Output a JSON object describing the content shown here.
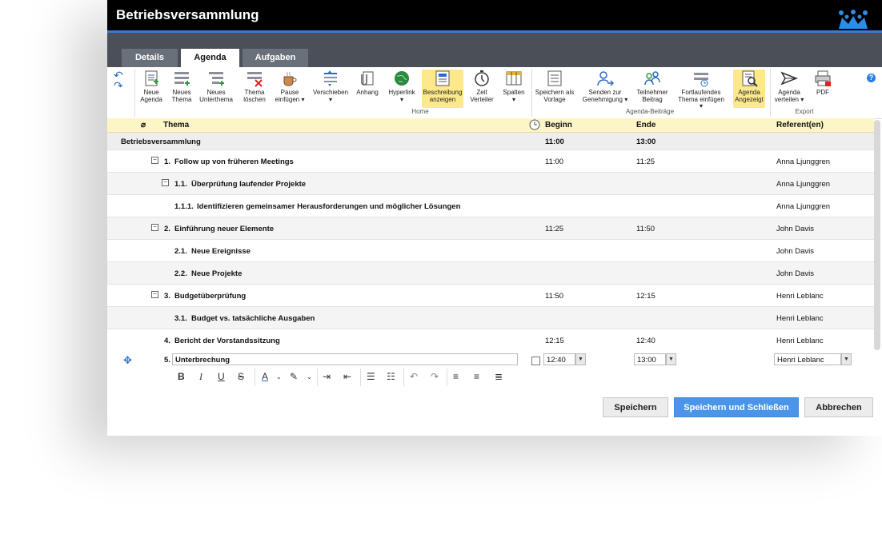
{
  "window": {
    "title": "Betriebsversammlung"
  },
  "tabs": [
    {
      "label": "Details"
    },
    {
      "label": "Agenda"
    },
    {
      "label": "Aufgaben"
    }
  ],
  "ribbon": {
    "buttons": [
      {
        "label": "Neue\nAgenda"
      },
      {
        "label": "Neues\nThema"
      },
      {
        "label": "Neues\nUnterthema"
      },
      {
        "label": "Thema\nlöschen"
      },
      {
        "label": "Pause\neinfügen ▾"
      },
      {
        "label": "Verschieben\n▾"
      },
      {
        "label": "Anhang"
      },
      {
        "label": "Hyperlink\n▾"
      },
      {
        "label": "Beschreibung\nanzeigen"
      },
      {
        "label": "Zeit\nVerteiler"
      },
      {
        "label": "Spalten\n▾"
      },
      {
        "label": "Speichern als\nVorlage"
      },
      {
        "label": "Senden zur\nGenehmigung ▾"
      },
      {
        "label": "Teilnehmer\nBeitrag"
      },
      {
        "label": "Fortlaufendes\nThema einfügen ▾"
      },
      {
        "label": "Agenda\nAngezeigt"
      },
      {
        "label": "Agenda\nverteilen ▾"
      },
      {
        "label": "PDF"
      }
    ],
    "groups": {
      "home": "Home",
      "agenda": "Agenda-Beiträge",
      "export": "Export"
    },
    "help": "?"
  },
  "grid": {
    "headers": {
      "thema": "Thema",
      "beginn": "Beginn",
      "ende": "Ende",
      "referent": "Referent(en)"
    },
    "root": {
      "title": "Betriebsversammlung",
      "beginn": "11:00",
      "ende": "13:00"
    },
    "rows": [
      {
        "num": "1.",
        "title": "Follow up von früheren Meetings",
        "beginn": "11:00",
        "ende": "11:25",
        "referent": "Anna Ljunggren"
      },
      {
        "num": "1.1.",
        "title": "Überprüfung laufender Projekte",
        "beginn": "",
        "ende": "",
        "referent": "Anna Ljunggren"
      },
      {
        "num": "1.1.1.",
        "title": "Identifizieren gemeinsamer Herausforderungen und möglicher Lösungen",
        "beginn": "",
        "ende": "",
        "referent": "Anna Ljunggren"
      },
      {
        "num": "2.",
        "title": "Einführung neuer Elemente",
        "beginn": "11:25",
        "ende": "11:50",
        "referent": "John Davis"
      },
      {
        "num": "2.1.",
        "title": "Neue Ereignisse",
        "beginn": "",
        "ende": "",
        "referent": "John Davis"
      },
      {
        "num": "2.2.",
        "title": "Neue Projekte",
        "beginn": "",
        "ende": "",
        "referent": "John Davis"
      },
      {
        "num": "3.",
        "title": "Budgetüberprüfung",
        "beginn": "11:50",
        "ende": "12:15",
        "referent": "Henri Leblanc"
      },
      {
        "num": "3.1.",
        "title": "Budget vs. tatsächliche Ausgaben",
        "beginn": "",
        "ende": "",
        "referent": "Henri Leblanc"
      },
      {
        "num": "4.",
        "title": "Bericht der Vorstandssitzung",
        "beginn": "12:15",
        "ende": "12:40",
        "referent": "Henri Leblanc"
      }
    ],
    "edit_row": {
      "num": "5.",
      "title": "Unterbrechung",
      "beginn": "12:40",
      "ende": "13:00",
      "referent": "Henri Leblanc"
    }
  },
  "footer": {
    "save": "Speichern",
    "save_close": "Speichern und Schließen",
    "cancel": "Abbrechen"
  },
  "colors": {
    "accent": "#4b95e8",
    "header_bg": "#fcf6c7",
    "highlight": "#fde88c",
    "titlebar": "#000000"
  }
}
